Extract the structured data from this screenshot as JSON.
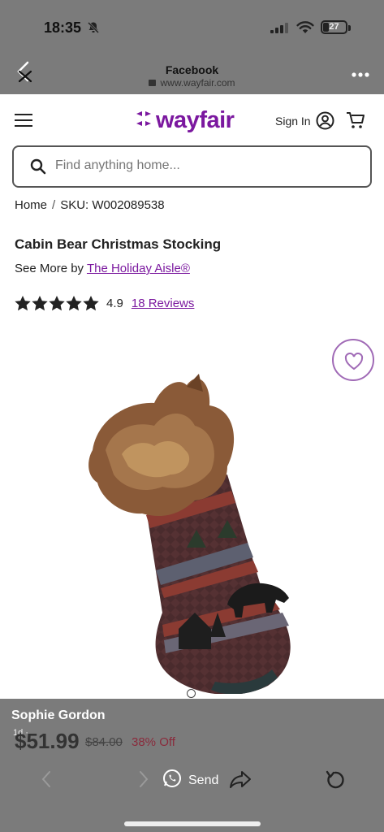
{
  "status": {
    "time": "18:35",
    "battery": "27",
    "battery_level": 0.27
  },
  "browser": {
    "title": "Facebook",
    "url": "www.wayfair.com"
  },
  "header": {
    "logo_text": "wayfair",
    "signin_label": "Sign In"
  },
  "search": {
    "placeholder": "Find anything home..."
  },
  "breadcrumb": {
    "home": "Home",
    "separator": "/",
    "sku": "SKU: W002089538"
  },
  "product": {
    "title": "Cabin Bear Christmas Stocking",
    "see_more_prefix": "See More by",
    "brand": "The Holiday Aisle®",
    "rating": "4.9",
    "rating_stars": 5,
    "reviews": "18 Reviews"
  },
  "overlay": {
    "poster": "Sophie Gordon",
    "meta": "1d · ",
    "price": "$51.99",
    "old_price": "$84.00",
    "discount": "38% Off",
    "send_label": "Send"
  },
  "colors": {
    "brand": "#7b189f",
    "overlay": "#7b7b7b",
    "discount": "#8a2b3c"
  },
  "icons": [
    "bell-muted-icon",
    "signal-icon",
    "wifi-icon",
    "battery-icon",
    "close-icon",
    "more-icon",
    "hamburger-icon",
    "wayfair-logo-icon",
    "account-icon",
    "cart-icon",
    "search-icon",
    "star-icon",
    "heart-icon",
    "chevron-left-icon",
    "chevron-right-icon",
    "whatsapp-icon",
    "share-icon",
    "reload-icon"
  ]
}
